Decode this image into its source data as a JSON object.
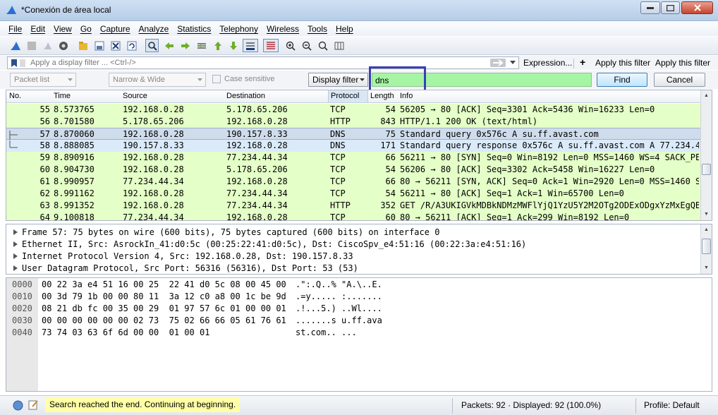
{
  "window": {
    "title": "*Conexión de área local"
  },
  "menu": [
    "File",
    "Edit",
    "View",
    "Go",
    "Capture",
    "Analyze",
    "Statistics",
    "Telephony",
    "Wireless",
    "Tools",
    "Help"
  ],
  "toolbar": {
    "icons": [
      "shark-fin-start-icon",
      "stop-capture-icon",
      "restart-capture-icon",
      "capture-options-icon",
      "open-file-icon",
      "save-file-icon",
      "close-file-icon",
      "reload-file-icon",
      "find-packet-icon",
      "go-back-icon",
      "go-forward-icon",
      "go-to-packet-icon",
      "go-first-icon",
      "go-last-icon",
      "auto-scroll-icon",
      "colorize-icon",
      "zoom-in-icon",
      "zoom-out-icon",
      "normal-size-icon",
      "resize-columns-icon"
    ],
    "active": "find-packet-icon"
  },
  "display_filter": {
    "placeholder": "Apply a display filter ... <Ctrl-/>",
    "expression_label": "Expression...",
    "plus_label": "+",
    "apply_label_1": "Apply this filter",
    "apply_label_2": "Apply this filter"
  },
  "find_bar": {
    "search_in": "Packet list",
    "char_width": "Narrow & Wide",
    "case_sensitive_label": "Case sensitive",
    "search_type": "Display filter",
    "value": "dns",
    "find_label": "Find",
    "cancel_label": "Cancel",
    "field_color": "#a5f5a5",
    "highlight_color": "#3b3fb4"
  },
  "packet_list": {
    "columns": [
      "No.",
      "Time",
      "Source",
      "Destination",
      "Protocol",
      "Length",
      "Info"
    ],
    "rows": [
      {
        "no": "55",
        "time": "8.573765",
        "src": "192.168.0.28",
        "dst": "5.178.65.206",
        "proto": "TCP",
        "len": "54",
        "info": "56205 → 80 [ACK] Seq=3301 Ack=5436 Win=16233 Len=0",
        "state": "normal"
      },
      {
        "no": "56",
        "time": "8.701580",
        "src": "5.178.65.206",
        "dst": "192.168.0.28",
        "proto": "HTTP",
        "len": "843",
        "info": "HTTP/1.1 200 OK  (text/html)",
        "state": "normal"
      },
      {
        "no": "57",
        "time": "8.870060",
        "src": "192.168.0.28",
        "dst": "190.157.8.33",
        "proto": "DNS",
        "len": "75",
        "info": "Standard query 0x576c A su.ff.avast.com",
        "state": "selected"
      },
      {
        "no": "58",
        "time": "8.888085",
        "src": "190.157.8.33",
        "dst": "192.168.0.28",
        "proto": "DNS",
        "len": "171",
        "info": "Standard query response 0x576c A su.ff.avast.com A 77.234.4…",
        "state": "related"
      },
      {
        "no": "59",
        "time": "8.890916",
        "src": "192.168.0.28",
        "dst": "77.234.44.34",
        "proto": "TCP",
        "len": "66",
        "info": "56211 → 80 [SYN] Seq=0 Win=8192 Len=0 MSS=1460 WS=4 SACK_PE…",
        "state": "normal"
      },
      {
        "no": "60",
        "time": "8.904730",
        "src": "192.168.0.28",
        "dst": "5.178.65.206",
        "proto": "TCP",
        "len": "54",
        "info": "56206 → 80 [ACK] Seq=3302 Ack=5458 Win=16227 Len=0",
        "state": "normal"
      },
      {
        "no": "61",
        "time": "8.990957",
        "src": "77.234.44.34",
        "dst": "192.168.0.28",
        "proto": "TCP",
        "len": "66",
        "info": "80 → 56211 [SYN, ACK] Seq=0 Ack=1 Win=2920 Len=0 MSS=1460 S…",
        "state": "normal"
      },
      {
        "no": "62",
        "time": "8.991162",
        "src": "192.168.0.28",
        "dst": "77.234.44.34",
        "proto": "TCP",
        "len": "54",
        "info": "56211 → 80 [ACK] Seq=1 Ack=1 Win=65700 Len=0",
        "state": "normal"
      },
      {
        "no": "63",
        "time": "8.991352",
        "src": "192.168.0.28",
        "dst": "77.234.44.34",
        "proto": "HTTP",
        "len": "352",
        "info": "GET /R/A3UKIGVkMDBkNDMzMWFlYjQ1YzU5Y2M2OTg2ODExODgxYzMxEgQBB…",
        "state": "normal"
      },
      {
        "no": "64",
        "time": "9.100818",
        "src": "77.234.44.34",
        "dst": "192.168.0.28",
        "proto": "TCP",
        "len": "60",
        "info": "80 → 56211 [ACK] Seq=1 Ack=299 Win=8192 Len=0",
        "state": "normal"
      }
    ],
    "colors": {
      "normal": "#e4ffc7",
      "selected": "#cfdceb",
      "related": "#daeaf9"
    }
  },
  "details": [
    "Frame 57: 75 bytes on wire (600 bits), 75 bytes captured (600 bits) on interface 0",
    "Ethernet II, Src: AsrockIn_41:d0:5c (00:25:22:41:d0:5c), Dst: CiscoSpv_e4:51:16 (00:22:3a:e4:51:16)",
    "Internet Protocol Version 4, Src: 192.168.0.28, Dst: 190.157.8.33",
    "User Datagram Protocol, Src Port: 56316 (56316), Dst Port: 53 (53)"
  ],
  "bytes": [
    {
      "offset": "0000",
      "hex": "00 22 3a e4 51 16 00 25  22 41 d0 5c 08 00 45 00",
      "ascii": ".\":.Q..% \"A.\\..E."
    },
    {
      "offset": "0010",
      "hex": "00 3d 79 1b 00 00 80 11  3a 12 c0 a8 00 1c be 9d",
      "ascii": ".=y..... :......."
    },
    {
      "offset": "0020",
      "hex": "08 21 db fc 00 35 00 29  01 97 57 6c 01 00 00 01",
      "ascii": ".!...5.) ..Wl...."
    },
    {
      "offset": "0030",
      "hex": "00 00 00 00 00 00 02 73  75 02 66 66 05 61 76 61",
      "ascii": ".......s u.ff.ava"
    },
    {
      "offset": "0040",
      "hex": "73 74 03 63 6f 6d 00 00  01 00 01",
      "ascii": "st.com.. ..."
    }
  ],
  "status": {
    "message": "Search reached the end. Continuing at beginning.",
    "message_bg": "#ffffa6",
    "packets": "Packets: 92 · Displayed: 92 (100.0%)",
    "profile": "Profile: Default"
  }
}
